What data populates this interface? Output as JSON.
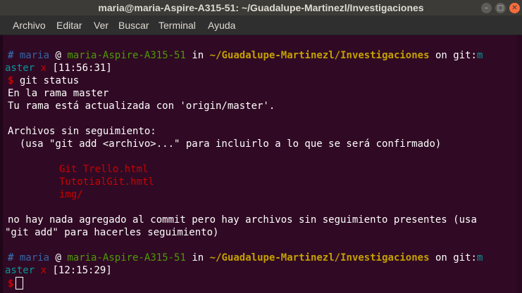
{
  "window": {
    "title": "maria@maria-Aspire-A315-51: ~/Guadalupe-Martinezl/Investigaciones",
    "minimize_symbol": "–",
    "maximize_symbol": "□",
    "close_symbol": "✕"
  },
  "menu": {
    "items": [
      "Archivo",
      "Editar",
      "Ver",
      "Buscar",
      "Terminal",
      "Ayuda"
    ]
  },
  "prompt1": {
    "hash": "#",
    "user": "maria",
    "at": "@",
    "host": "maria-Aspire-A315-51",
    "in": "in",
    "path": "~/Guadalupe-Martinezl/Investigaciones",
    "on": "on",
    "git": "git:",
    "branch_start": "m",
    "branch_rest": "aster",
    "dirty": "x",
    "time": "[11:56:31]",
    "dollar": "$",
    "command": "git status"
  },
  "output": {
    "line1": "En la rama master",
    "line2": "Tu rama está actualizada con 'origin/master'.",
    "line3": "Archivos sin seguimiento:",
    "line4": "  (usa \"git add <archivo>...\" para incluirlo a lo que se será confirmado)",
    "files": [
      "Git Trello.html",
      "TutotialGit.hmtl",
      "img/"
    ],
    "line5": "no hay nada agregado al commit pero hay archivos sin seguimiento presentes (usa",
    "line6": "\"git add\" para hacerles seguimiento)"
  },
  "prompt2": {
    "hash": "#",
    "user": "maria",
    "at": "@",
    "host": "maria-Aspire-A315-51",
    "in": "in",
    "path": "~/Guadalupe-Martinezl/Investigaciones",
    "on": "on",
    "git": "git:",
    "branch_start": "m",
    "branch_rest": "aster",
    "dirty": "x",
    "time": "[12:15:29]",
    "dollar": "$"
  },
  "colors": {
    "background": "#300a24",
    "prompt_hash": "#3465a4",
    "host": "#4e9a06",
    "path": "#c4a000",
    "branch": "#06989a",
    "dirty": "#cc0000",
    "untracked": "#cc0000"
  }
}
